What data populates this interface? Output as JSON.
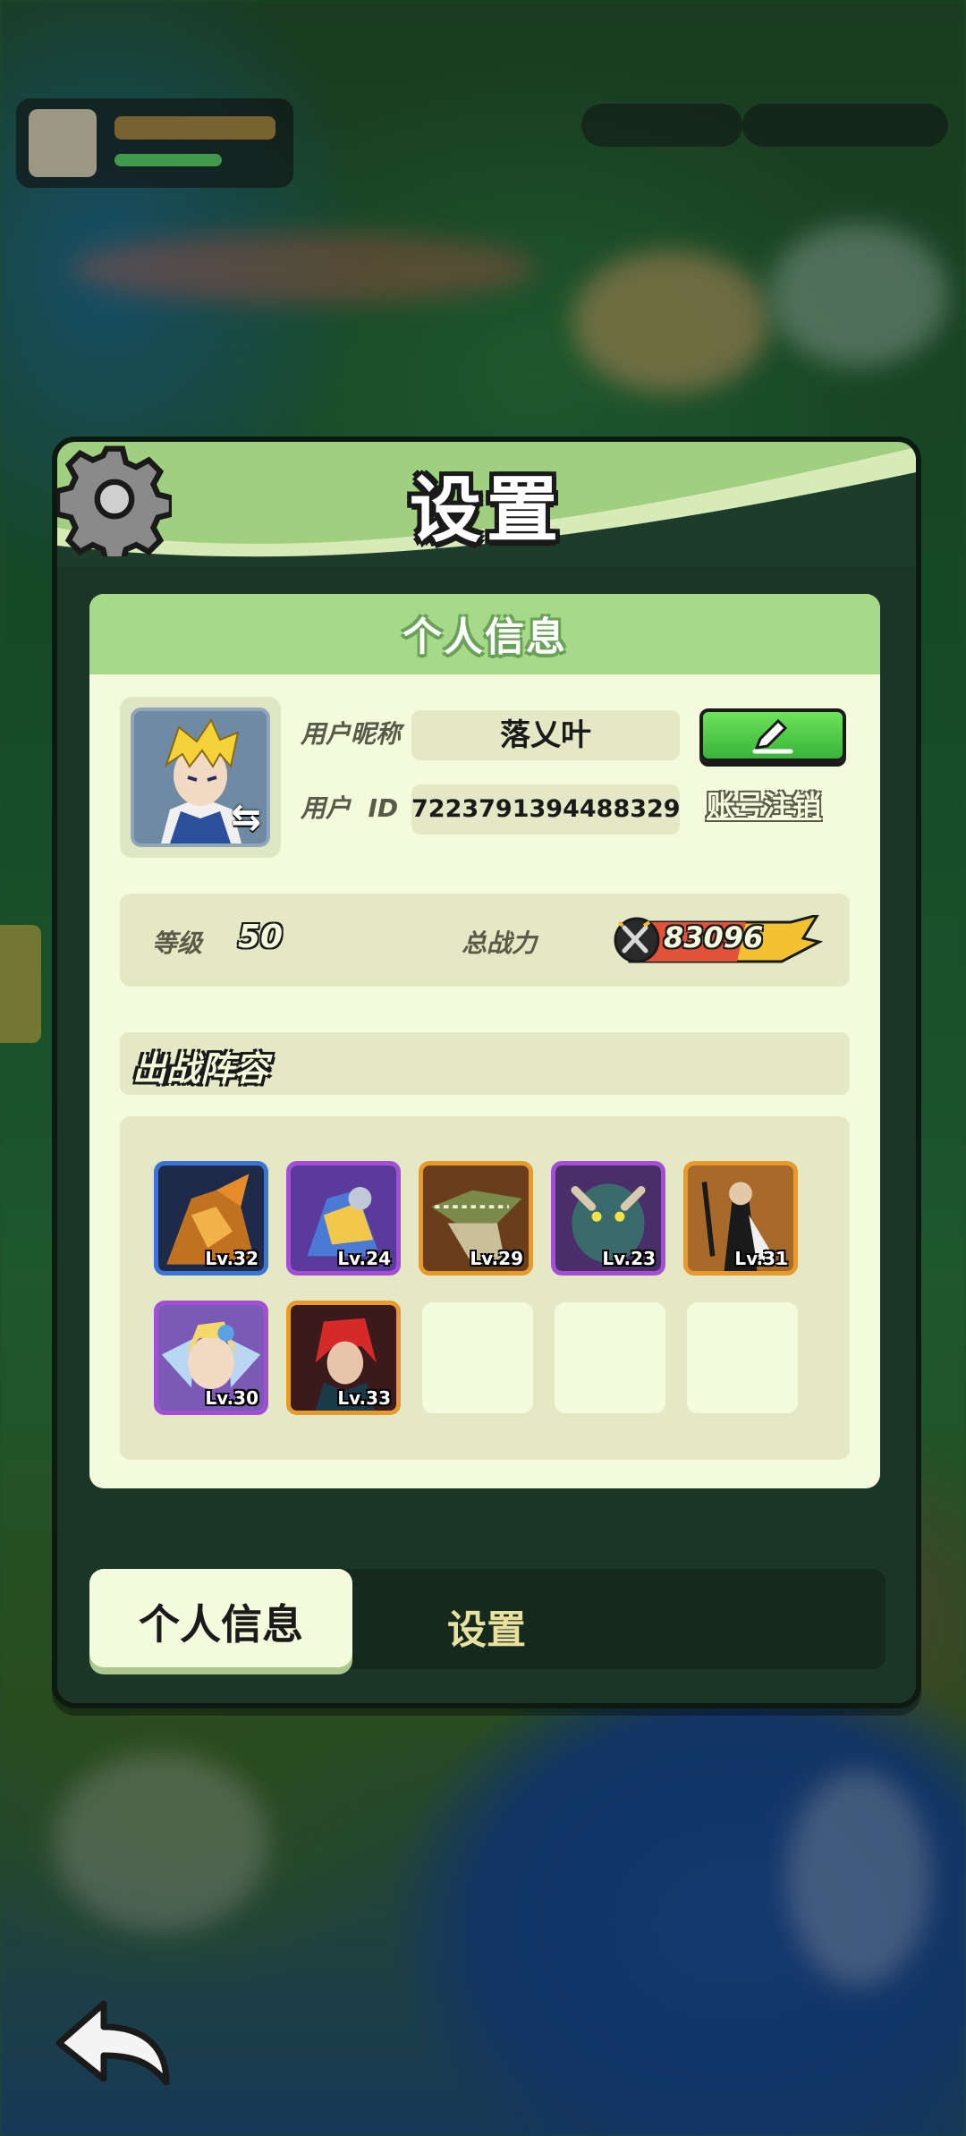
{
  "dialog": {
    "title": "设置",
    "section_title": "个人信息"
  },
  "profile": {
    "nickname_label": "用户昵称",
    "nickname": "落乂叶",
    "id_label": "用户  ID",
    "user_id": "7223791394488329",
    "cancel_account_label": "账号注销",
    "level_label": "等级",
    "level": "50",
    "power_label": "总战力",
    "power": "83096"
  },
  "lineup": {
    "title": "出战阵容",
    "heroes": [
      {
        "level": "Lv.32",
        "frame": "#3b73d6"
      },
      {
        "level": "Lv.24",
        "frame": "#a24fd6"
      },
      {
        "level": "Lv.29",
        "frame": "#e79a2b"
      },
      {
        "level": "Lv.23",
        "frame": "#a24fd6"
      },
      {
        "level": "Lv.31",
        "frame": "#e79a2b"
      },
      {
        "level": "Lv.30",
        "frame": "#a24fd6"
      },
      {
        "level": "Lv.33",
        "frame": "#e79a2b"
      }
    ],
    "empty_slots": 3
  },
  "tabs": [
    {
      "label": "个人信息",
      "active": true
    },
    {
      "label": "设置",
      "active": false
    }
  ],
  "icons": {
    "gear": "gear-icon",
    "edit": "pencil-icon",
    "swap": "swap-icon",
    "back": "back-arrow-icon",
    "power": "crossed-swords-icon"
  }
}
